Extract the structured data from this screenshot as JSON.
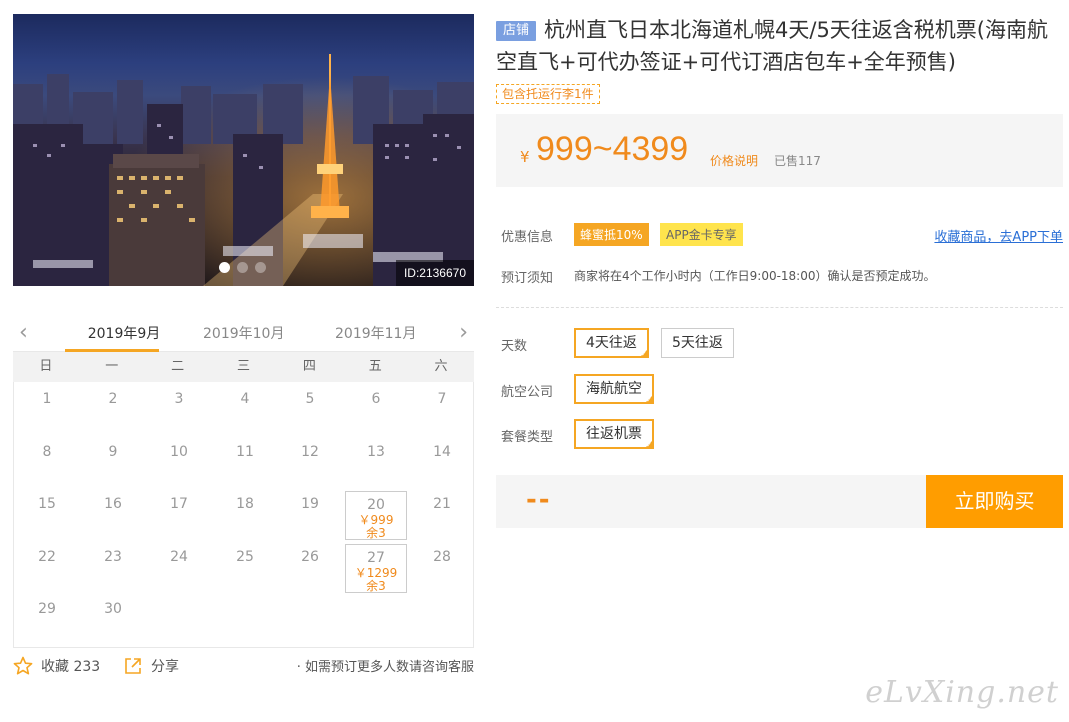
{
  "hero": {
    "image_id": "ID:2136670",
    "dots": 3,
    "active_dot": 0
  },
  "calendar": {
    "months": [
      "2019年9月",
      "2019年10月",
      "2019年11月"
    ],
    "active_month": 0,
    "weekdays": [
      "日",
      "一",
      "二",
      "三",
      "四",
      "五",
      "六"
    ],
    "days": [
      {
        "d": "1"
      },
      {
        "d": "2"
      },
      {
        "d": "3"
      },
      {
        "d": "4"
      },
      {
        "d": "5"
      },
      {
        "d": "6"
      },
      {
        "d": "7"
      },
      {
        "d": "8"
      },
      {
        "d": "9"
      },
      {
        "d": "10"
      },
      {
        "d": "11"
      },
      {
        "d": "12"
      },
      {
        "d": "13"
      },
      {
        "d": "14"
      },
      {
        "d": "15"
      },
      {
        "d": "16"
      },
      {
        "d": "17"
      },
      {
        "d": "18"
      },
      {
        "d": "19"
      },
      {
        "d": "20",
        "price": "￥999",
        "stock": "余3"
      },
      {
        "d": "21"
      },
      {
        "d": "22"
      },
      {
        "d": "23"
      },
      {
        "d": "24"
      },
      {
        "d": "25"
      },
      {
        "d": "26"
      },
      {
        "d": "27",
        "price": "￥1299",
        "stock": "余3"
      },
      {
        "d": "28"
      },
      {
        "d": "29"
      },
      {
        "d": "30"
      }
    ]
  },
  "actions": {
    "favorite": "收藏 233",
    "share": "分享",
    "note": "· 如需预订更多人数请咨询客服"
  },
  "product": {
    "shop_tag": "店铺",
    "title": "杭州直飞日本北海道札幌4天/5天往返含税机票(海南航空直飞+可代办签证+可代订酒店包车+全年预售)",
    "luggage_tag": "包含托运行李1件",
    "currency": "¥",
    "price_range": "999~4399",
    "price_explain": "价格说明",
    "sold": "已售117"
  },
  "promo": {
    "label": "优惠信息",
    "tag1": "蜂蜜抵10%",
    "tag2": "APP金卡专享",
    "fav_link": "收藏商品，去APP下单"
  },
  "notice": {
    "label": "预订须知",
    "text": "商家将在4个工作小时内（工作日9:00-18:00）确认是否预定成功。"
  },
  "options": {
    "days_label": "天数",
    "days": [
      "4天往返",
      "5天往返"
    ],
    "days_selected": 0,
    "airline_label": "航空公司",
    "airline": "海航航空",
    "package_label": "套餐类型",
    "package": "往返机票"
  },
  "buy": {
    "total": "--",
    "button": "立即购买"
  },
  "watermark": "eLvXing.net",
  "colors": {
    "accent": "#f5a623",
    "price": "#f08a1c",
    "buy_button": "#ff9d00",
    "shop_tag": "#7a9fe0",
    "link": "#2a6fd6"
  }
}
